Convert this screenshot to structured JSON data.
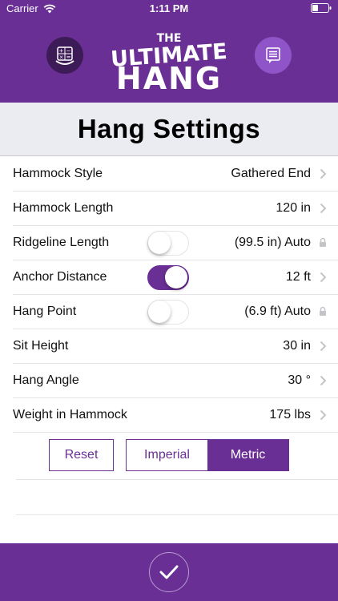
{
  "status_bar": {
    "carrier": "Carrier",
    "time": "1:11 PM"
  },
  "header": {
    "logo": {
      "line1": "THE",
      "line2": "ULTIMATE",
      "line3": "HANG"
    },
    "calculator_icon": "calculator-icon",
    "chat_icon": "chat-icon"
  },
  "title": "Hang Settings",
  "rows": [
    {
      "label": "Hammock Style",
      "value": "Gathered End",
      "accessory": "chevron"
    },
    {
      "label": "Hammock Length",
      "value": "120 in",
      "accessory": "chevron"
    },
    {
      "label": "Ridgeline Length",
      "value": "(99.5 in) Auto",
      "accessory": "lock",
      "toggle": "off"
    },
    {
      "label": "Anchor Distance",
      "value": "12 ft",
      "accessory": "chevron",
      "toggle": "on"
    },
    {
      "label": "Hang Point",
      "value": "(6.9 ft) Auto",
      "accessory": "lock",
      "toggle": "off"
    },
    {
      "label": "Sit Height",
      "value": "30 in",
      "accessory": "chevron"
    },
    {
      "label": "Hang Angle",
      "value": "30 °",
      "accessory": "chevron"
    },
    {
      "label": "Weight in Hammock",
      "value": "175 lbs",
      "accessory": "chevron"
    }
  ],
  "buttons": {
    "reset": "Reset",
    "units": {
      "imperial": "Imperial",
      "metric": "Metric",
      "selected": "Metric"
    }
  },
  "colors": {
    "brand": "#6a2f94",
    "brand_dark": "#3d1b57",
    "brand_light": "#8f54c7"
  }
}
